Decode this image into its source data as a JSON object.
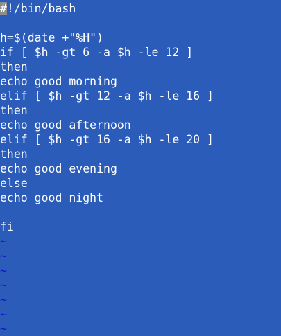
{
  "editor": {
    "cursor_char": "#",
    "first_line_rest": "!/bin/bash",
    "lines": [
      "",
      "h=$(date +\"%H\")",
      "if [ $h -gt 6 -a $h -le 12 ]",
      "then",
      "echo good morning",
      "elif [ $h -gt 12 -a $h -le 16 ]",
      "then",
      "echo good afternoon",
      "elif [ $h -gt 16 -a $h -le 20 ]",
      "then",
      "echo good evening",
      "else",
      "echo good night",
      "",
      "fi"
    ],
    "empty_marker": "~",
    "empty_line_count": 7
  },
  "colors": {
    "background": "#2b5cb9",
    "text": "#ffffff",
    "tilde": "#1414d8",
    "cursor": "#8c8c8c"
  }
}
